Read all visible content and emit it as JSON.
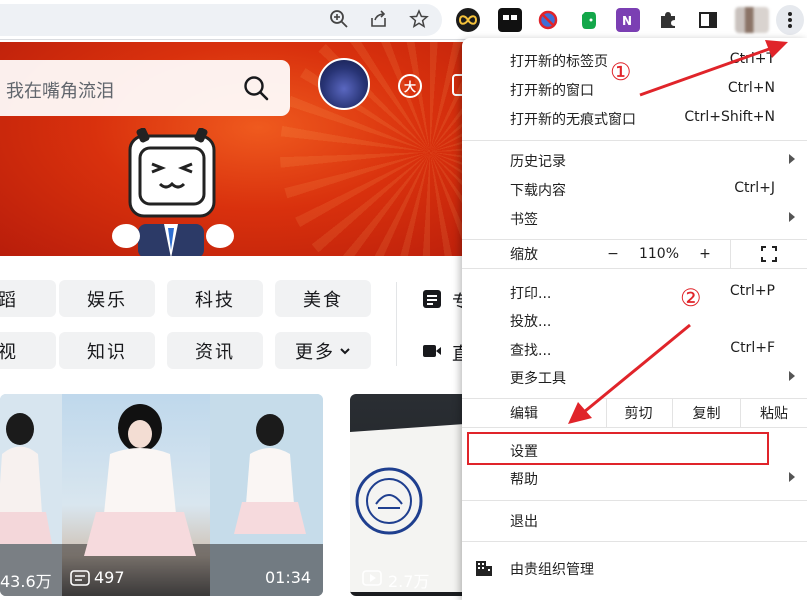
{
  "page": {
    "search_placeholder": "我在嘴角流泪",
    "big_icon_text": "大",
    "categories_row1": [
      "蹈",
      "娱乐",
      "科技",
      "美食"
    ],
    "categories_row2": [
      "视",
      "知识",
      "资讯",
      "更多"
    ],
    "side_links": [
      "专",
      "直"
    ],
    "video1": {
      "views": "43.6万",
      "danmaku": "497",
      "duration": "01:34"
    },
    "video2": {
      "views": "2.7万"
    }
  },
  "menu": {
    "items_top": [
      {
        "label": "打开新的标签页",
        "shortcut": "Ctrl+T"
      },
      {
        "label": "打开新的窗口",
        "shortcut": "Ctrl+N"
      },
      {
        "label": "打开新的无痕式窗口",
        "shortcut": "Ctrl+Shift+N"
      }
    ],
    "items_history": [
      {
        "label": "历史记录",
        "shortcut": ""
      },
      {
        "label": "下载内容",
        "shortcut": "Ctrl+J"
      },
      {
        "label": "书签",
        "shortcut": ""
      }
    ],
    "zoom": {
      "label": "缩放",
      "minus": "−",
      "value": "110%",
      "plus": "+"
    },
    "items_tools": [
      {
        "label": "打印...",
        "shortcut": "Ctrl+P"
      },
      {
        "label": "投放...",
        "shortcut": ""
      },
      {
        "label": "查找...",
        "shortcut": "Ctrl+F"
      },
      {
        "label": "更多工具",
        "shortcut": ""
      }
    ],
    "edit": {
      "label": "编辑",
      "cut": "剪切",
      "copy": "复制",
      "paste": "粘贴"
    },
    "settings": "设置",
    "help": "帮助",
    "exit": "退出",
    "managed": "由贵组织管理"
  },
  "annotations": {
    "step1": "①",
    "step2": "②",
    "color": "#e0242a"
  }
}
